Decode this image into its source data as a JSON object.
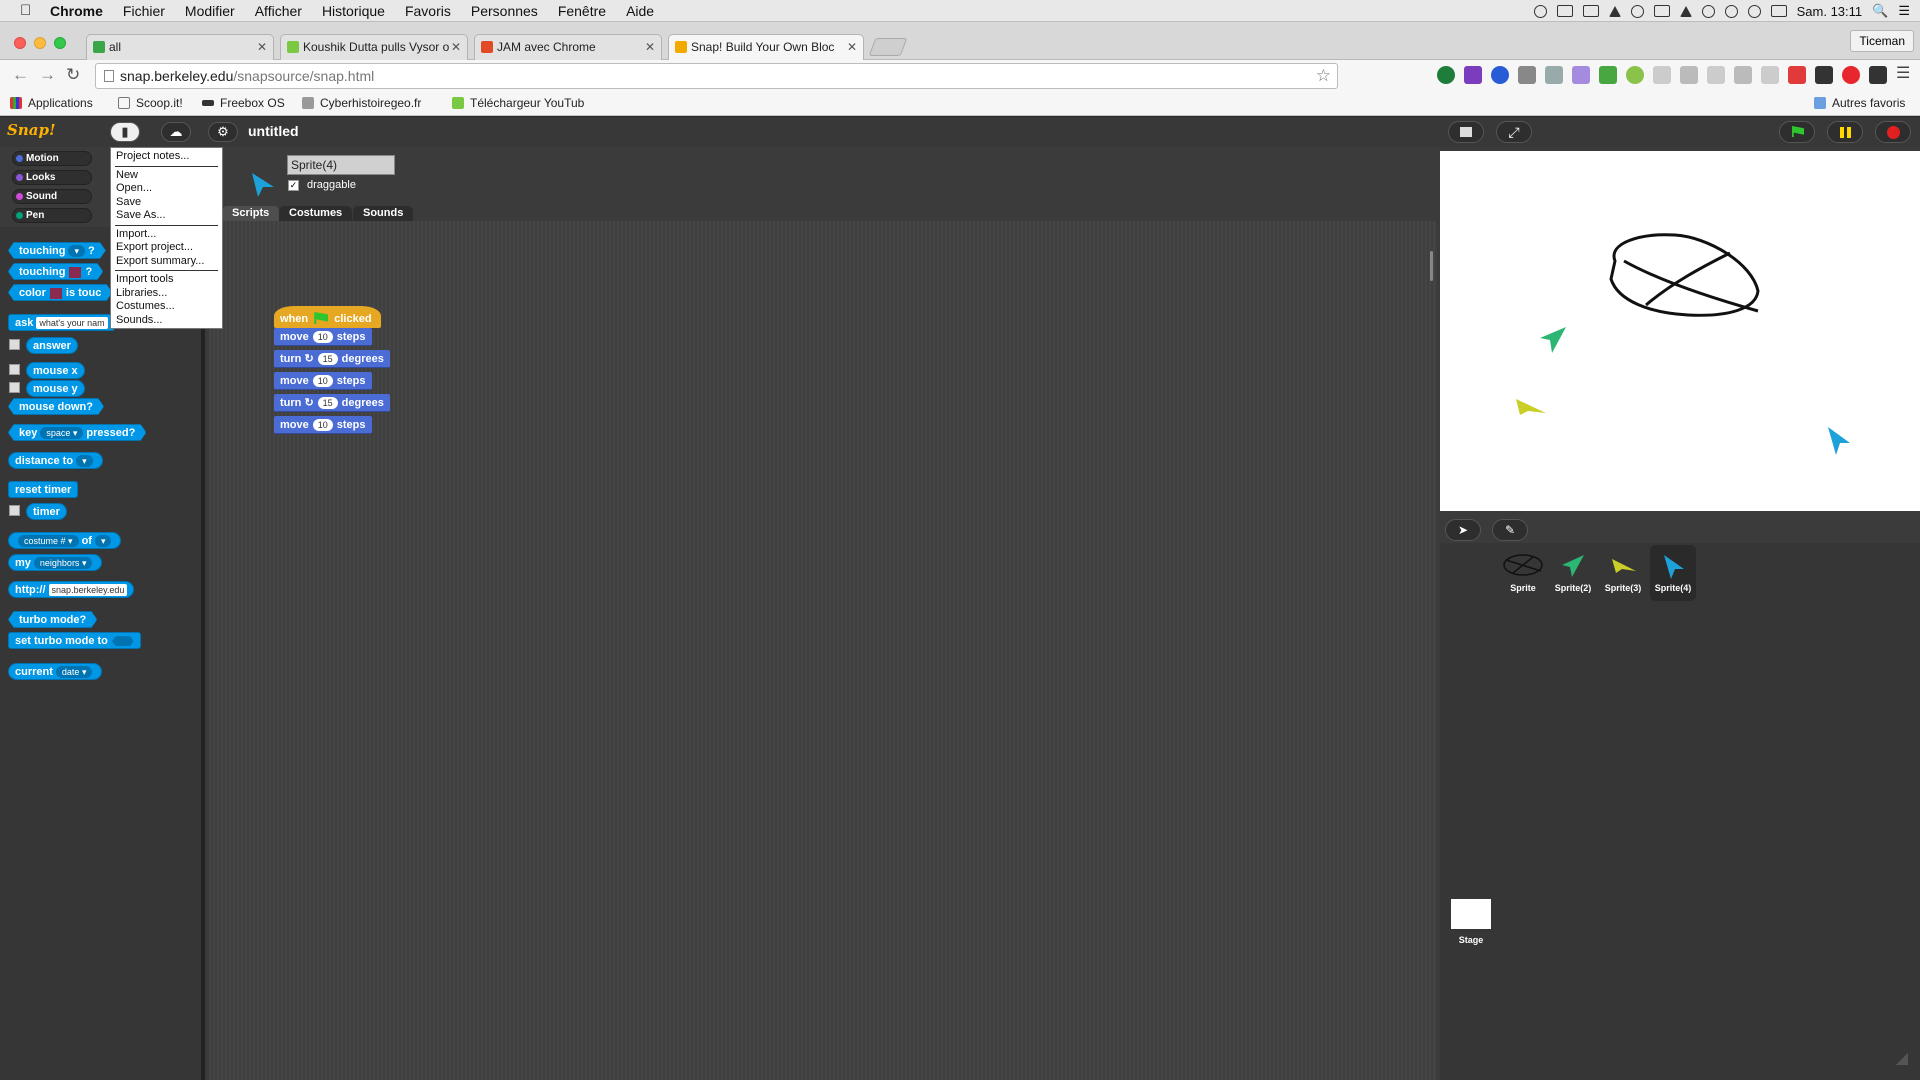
{
  "mac_menubar": {
    "app": "Chrome",
    "items": [
      "Fichier",
      "Modifier",
      "Afficher",
      "Historique",
      "Favoris",
      "Personnes",
      "Fenêtre",
      "Aide"
    ],
    "clock": "Sam. 13:11"
  },
  "browser": {
    "tabs": [
      {
        "title": "all",
        "favicon_color": "#3aa64a"
      },
      {
        "title": "Koushik Dutta pulls Vysor o",
        "favicon_color": "#7ac943"
      },
      {
        "title": "JAM avec Chrome",
        "favicon_color": "#e04a24"
      },
      {
        "title": "Snap! Build Your Own Bloc",
        "favicon_color": "#f2a900"
      }
    ],
    "profile": "Ticeman",
    "url_host": "snap.berkeley.edu",
    "url_path": "/snapsource/snap.html",
    "bookmarks": [
      "Applications",
      "Scoop.it!",
      "Freebox OS",
      "Cyberhistoiregeo.fr",
      "Téléchargeur YouTub"
    ],
    "other_bookmarks": "Autres favoris"
  },
  "snap": {
    "logo": "Snap!",
    "project_title": "untitled",
    "categories": [
      {
        "label": "Motion",
        "color": "#4a6cd4"
      },
      {
        "label": "Looks",
        "color": "#8a55d7"
      },
      {
        "label": "Sound",
        "color": "#cf4ad9"
      },
      {
        "label": "Pen",
        "color": "#00a178"
      }
    ],
    "file_menu": {
      "group1": [
        "Project notes..."
      ],
      "group2": [
        "New",
        "Open...",
        "Save",
        "Save As..."
      ],
      "group3": [
        "Import...",
        "Export project...",
        "Export summary..."
      ],
      "group4": [
        "Import tools",
        "Libraries...",
        "Costumes...",
        "Sounds..."
      ]
    },
    "palette": {
      "touching": "touching",
      "q": "?",
      "color": "color",
      "is_touching": "is touc",
      "ask": "ask",
      "ask_default": "what's your nam",
      "answer": "answer",
      "mouse_x": "mouse x",
      "mouse_y": "mouse y",
      "mouse_down": "mouse down?",
      "key": "key",
      "key_value": "space",
      "pressed": "pressed?",
      "distance_to": "distance to",
      "reset_timer": "reset timer",
      "timer": "timer",
      "costume_num": "costume #",
      "of": "of",
      "my": "my",
      "neighbors": "neighbors",
      "http": "http://",
      "http_value": "snap.berkeley.edu",
      "turbo_mode": "turbo mode?",
      "set_turbo": "set turbo mode to",
      "current": "current",
      "date": "date"
    },
    "sprite": {
      "name": "Sprite(4)",
      "draggable_label": "draggable",
      "draggable": true
    },
    "tabs": [
      "Scripts",
      "Costumes",
      "Sounds"
    ],
    "script": {
      "hat_when": "when",
      "hat_clicked": "clicked",
      "blocks": [
        {
          "pre": "move",
          "value": "10",
          "post": "steps"
        },
        {
          "pre": "turn ↻",
          "value": "15",
          "post": "degrees"
        },
        {
          "pre": "move",
          "value": "10",
          "post": "steps"
        },
        {
          "pre": "turn ↻",
          "value": "15",
          "post": "degrees"
        },
        {
          "pre": "move",
          "value": "10",
          "post": "steps"
        }
      ]
    },
    "corral": {
      "sprites": [
        "Sprite",
        "Sprite(2)",
        "Sprite(3)",
        "Sprite(4)"
      ],
      "stage_label": "Stage"
    }
  }
}
